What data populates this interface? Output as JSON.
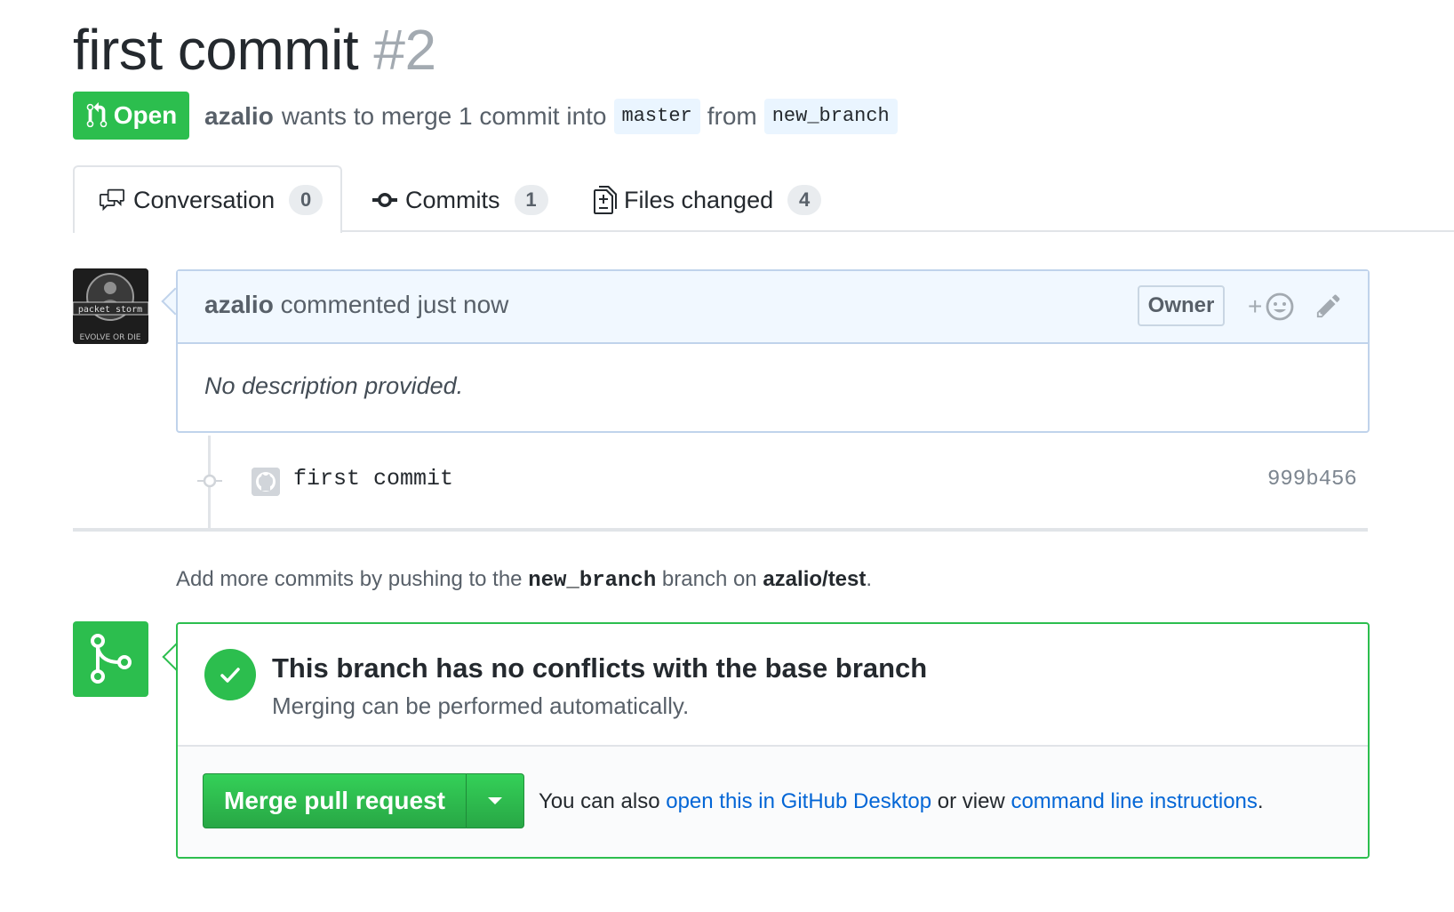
{
  "pr": {
    "title": "first commit",
    "number": "#2",
    "state_label": "Open",
    "author": "azalio",
    "merge_text": "wants to merge 1 commit into",
    "base_branch": "master",
    "from_text": "from",
    "head_branch": "new_branch"
  },
  "tabs": [
    {
      "label": "Conversation",
      "count": "0",
      "icon": "comment-discussion-icon"
    },
    {
      "label": "Commits",
      "count": "1",
      "icon": "git-commit-icon"
    },
    {
      "label": "Files changed",
      "count": "4",
      "icon": "diff-icon"
    }
  ],
  "comment": {
    "author": "azalio",
    "action": "commented just now",
    "role_badge": "Owner",
    "reaction_label": "+",
    "body": "No description provided."
  },
  "commit": {
    "message": "first commit",
    "sha": "999b456"
  },
  "push_hint": {
    "prefix": "Add more commits by pushing to the",
    "branch": "new_branch",
    "middle": "branch on",
    "repo": "azalio/test",
    "suffix": "."
  },
  "merge": {
    "title": "This branch has no conflicts with the base branch",
    "subtitle": "Merging can be performed automatically.",
    "button_label": "Merge pull request",
    "help_prefix": "You can also",
    "help_link1": "open this in GitHub Desktop",
    "help_middle": "or view",
    "help_link2": "command line instructions",
    "help_suffix": "."
  },
  "colors": {
    "open_green": "#2cbe4e",
    "link_blue": "#0366d6",
    "comment_header_bg": "#f1f8ff"
  }
}
